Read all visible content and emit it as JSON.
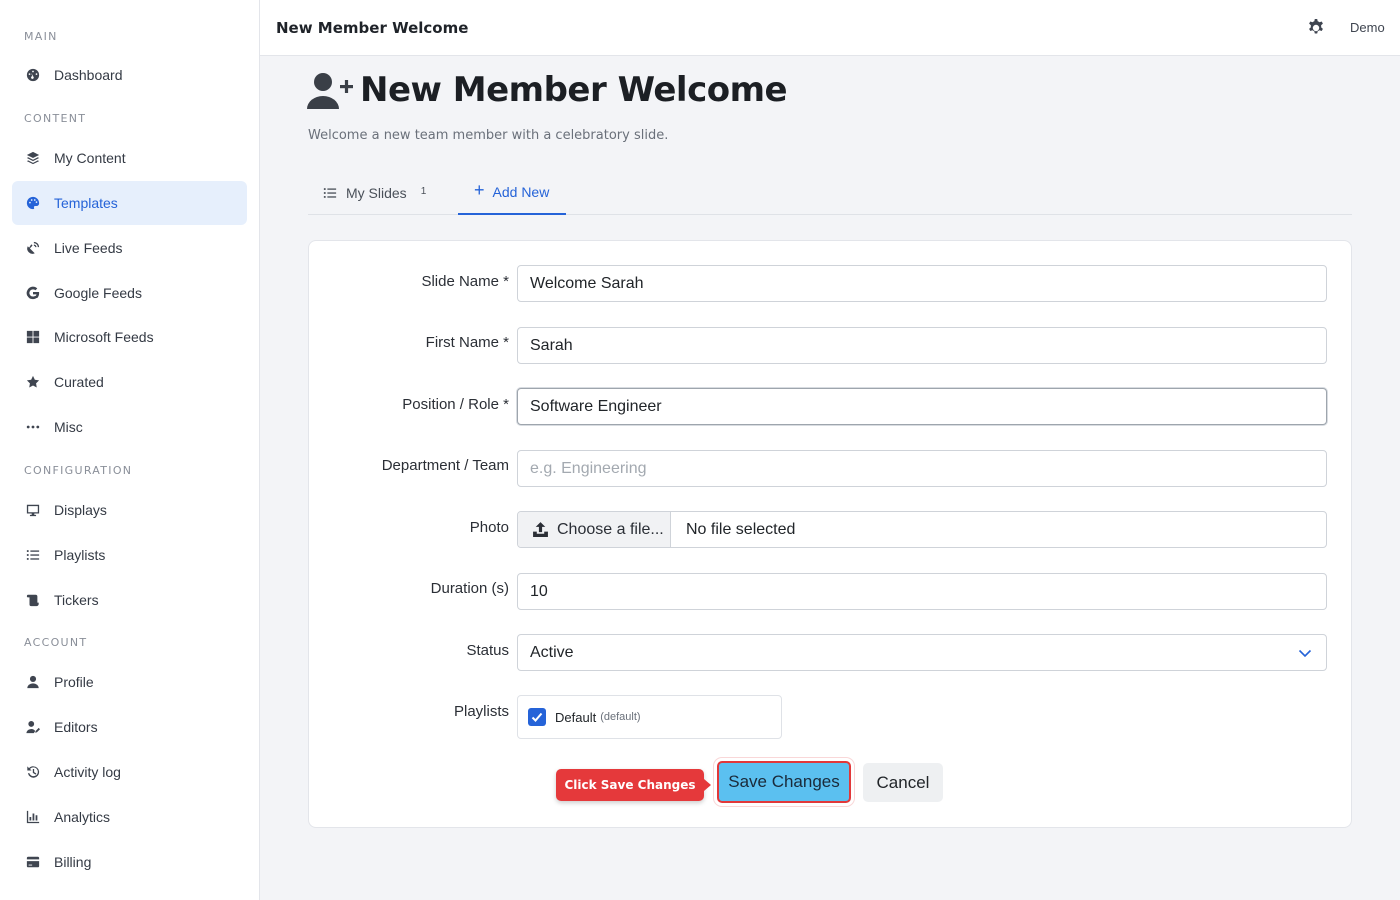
{
  "sidebar": {
    "sections": {
      "main": "MAIN",
      "content": "CONTENT",
      "configuration": "CONFIGURATION",
      "account": "ACCOUNT"
    },
    "items": {
      "dashboard": "Dashboard",
      "my_content": "My Content",
      "templates": "Templates",
      "live_feeds": "Live Feeds",
      "google_feeds": "Google Feeds",
      "microsoft_feeds": "Microsoft Feeds",
      "curated": "Curated",
      "misc": "Misc",
      "displays": "Displays",
      "playlists": "Playlists",
      "tickers": "Tickers",
      "profile": "Profile",
      "editors": "Editors",
      "activity_log": "Activity log",
      "analytics": "Analytics",
      "billing": "Billing"
    },
    "active_item": "Templates"
  },
  "topbar": {
    "title": "New Member Welcome",
    "user": "Demo"
  },
  "page": {
    "title": "New Member Welcome",
    "subtitle": "Welcome a new team member with a celebratory slide."
  },
  "tabs": {
    "my_slides": "My Slides",
    "my_slides_count": "1",
    "add_new": "Add New"
  },
  "form": {
    "slide_name_label": "Slide Name *",
    "slide_name_value": "Welcome Sarah",
    "first_name_label": "First Name *",
    "first_name_value": "Sarah",
    "position_label": "Position / Role *",
    "position_value": "Software Engineer",
    "department_label": "Department / Team",
    "department_placeholder": "e.g. Engineering",
    "photo_label": "Photo",
    "photo_button": "Choose a file...",
    "photo_status": "No file selected",
    "duration_label": "Duration (s)",
    "duration_value": "10",
    "status_label": "Status",
    "status_value": "Active",
    "playlists_label": "Playlists",
    "playlist_name": "Default",
    "playlist_tag": "(default)",
    "playlist_checked": true,
    "save_button": "Save Changes",
    "cancel_button": "Cancel"
  },
  "callout": {
    "text": "Click Save Changes"
  },
  "colors": {
    "accent": "#2563d8",
    "save_button": "#5bc0f0",
    "highlight": "#e2383a"
  }
}
